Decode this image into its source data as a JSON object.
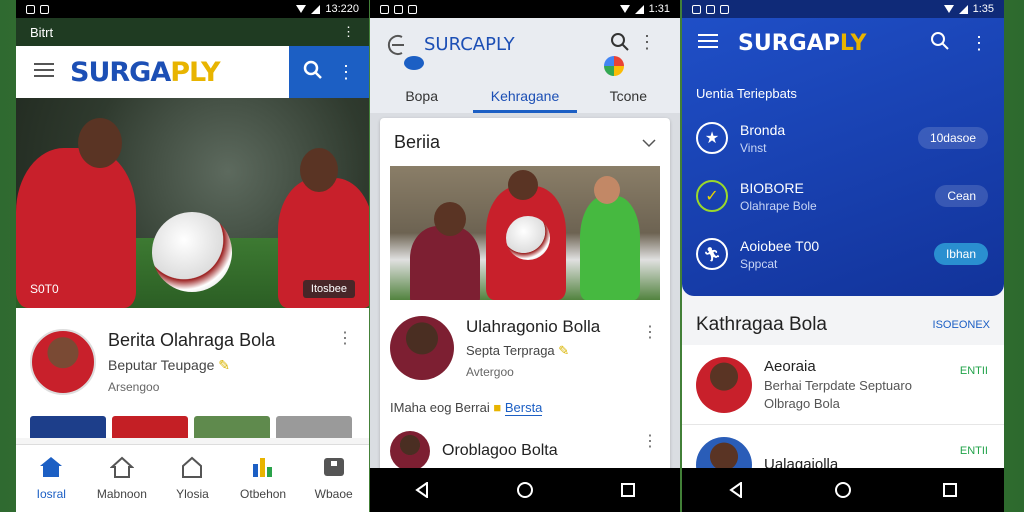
{
  "phone1": {
    "status": {
      "time": "13:220"
    },
    "topstrip_label": "Bitrt",
    "brand": {
      "part1": "SURGA",
      "part2": "PLY"
    },
    "hero": {
      "caption": "S0T0",
      "badge": "Itosbee"
    },
    "card": {
      "title": "Berita Olahraga Bola",
      "subtitle": "Beputar Teupage",
      "meta": "Arsengoo"
    },
    "bottom_nav": [
      {
        "label": "Iosral",
        "icon": "home-icon"
      },
      {
        "label": "Mabnoon",
        "icon": "house-outline-icon"
      },
      {
        "label": "Ylosia",
        "icon": "house-alt-icon"
      },
      {
        "label": "Otbehon",
        "icon": "chart-icon"
      },
      {
        "label": "Wbaoe",
        "icon": "box-icon"
      }
    ]
  },
  "phone2": {
    "status": {
      "time": "1:31"
    },
    "brand": "SURCAPLY",
    "tabs": [
      "Bopa",
      "Kehragane",
      "Tcone"
    ],
    "card_title": "Beriia",
    "row": {
      "title": "Ulahragonio  Bolla",
      "subtitle": "Septa Terpraga",
      "meta": "Avtergoo"
    },
    "inline": {
      "text": "IMaha eog Berrai",
      "tag": "Bersta"
    },
    "bottom_title": "Oroblagoo Bolta"
  },
  "phone3": {
    "status": {
      "time": "1:35"
    },
    "brand": {
      "part1": "SURGAP",
      "part2": "LY"
    },
    "section_title": "Uentia Teriepbats",
    "items": [
      {
        "title": "Bronda",
        "sub": "Vinst",
        "pill": "10dasoe"
      },
      {
        "title": "BIOBORE",
        "sub": "Olahrape Bole",
        "pill": "Cean"
      },
      {
        "title": "Aoiobee T00",
        "sub": "Sppcat",
        "pill": "Ibhan"
      }
    ],
    "list_title": "Kathragaa Bola",
    "list_link": "ISOEONEX",
    "list_items": [
      {
        "title": "Aeoraia",
        "sub1": "Berhai Terpdate Septuaro",
        "sub2": "Olbrago Bola",
        "tag": "ENTII"
      },
      {
        "title": "Ualagaiolla",
        "sub1": "",
        "sub2": "",
        "tag": "ENTII"
      }
    ]
  }
}
